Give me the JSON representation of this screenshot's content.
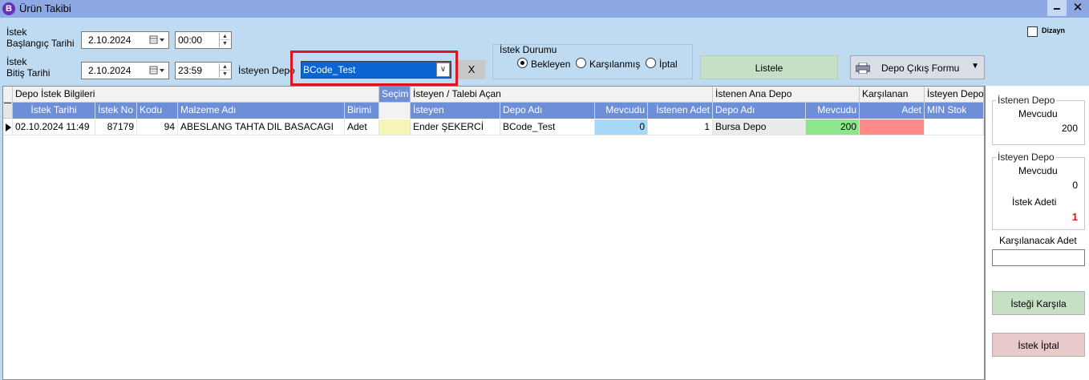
{
  "window": {
    "icon_letter": "B",
    "title": "Ürün Takibi",
    "minimize": "🗕",
    "close": "✕"
  },
  "filters": {
    "start_label_1": "İstek",
    "start_label_2": "Başlangıç Tarihi",
    "start_date": "2.10.2024",
    "start_time": "00:00",
    "end_label_1": "İstek",
    "end_label_2": "Bitiş Tarihi",
    "end_date": "2.10.2024",
    "end_time": "23:59",
    "depo_label": "İsteyen Depo",
    "depo_value": "BCode_Test",
    "clear_button": "X"
  },
  "status": {
    "title": "İstek Durumu",
    "options": [
      {
        "label": "Bekleyen",
        "selected": true
      },
      {
        "label": "Karşılanmış",
        "selected": false
      },
      {
        "label": "İptal",
        "selected": false
      }
    ]
  },
  "buttons": {
    "listele": "Listele",
    "cikis_formu": "Depo Çıkış Formu"
  },
  "dizayn": {
    "label": "Dizayn",
    "checked": false
  },
  "grid": {
    "bands": {
      "depo_istek": "Depo İstek Bilgileri",
      "secim": "Seçim",
      "isteyen": "İsteyen / Talebi Açan",
      "istenen_ana": "İstenen Ana Depo",
      "karsilanan": "Karşılanan",
      "isteyen_depo": "İsteyen Depo"
    },
    "columns": {
      "istek_tarihi": "İstek Tarihi",
      "istek_no": "İstek No",
      "kodu": "Kodu",
      "malzeme_adi": "Malzeme Adı",
      "birimi": "Birimi",
      "isteyen": "İsteyen",
      "depo_adi": "Depo Adı",
      "mevcudu": "Mevcudu",
      "istenen_adet": "İstenen Adet",
      "ana_depo_adi": "Depo Adı",
      "ana_mevcudu": "Mevcudu",
      "adet": "Adet",
      "min_stok": "MIN Stok"
    },
    "rows": [
      {
        "istek_tarihi": "02.10.2024 11:49",
        "istek_no": "87179",
        "kodu": "94",
        "malzeme_adi": "ABESLANG TAHTA DIL BASACAGI",
        "birimi": "Adet",
        "isteyen": "Ender ŞEKERCİ",
        "depo_adi": "BCode_Test",
        "mevcudu": "0",
        "istenen_adet": "1",
        "ana_depo_adi": "Bursa Depo",
        "ana_mevcudu": "200",
        "adet": "",
        "min_stok": ""
      }
    ]
  },
  "side": {
    "istenen_depo_title": "İstenen Depo",
    "istenen_mevcudu_label": "Mevcudu",
    "istenen_mevcudu_value": "200",
    "isteyen_depo_title": "İsteyen Depo",
    "isteyen_mevcudu_label": "Mevcudu",
    "isteyen_mevcudu_value": "0",
    "istek_adeti_label": "İstek Adeti",
    "istek_adeti_value": "1",
    "karsilanacak_label": "Karşılanacak Adet",
    "karsilanacak_value": "",
    "karsila_button": "İsteği Karşıla",
    "iptal_button": "İstek İptal"
  },
  "colors": {
    "header_blue": "#6d8fd8",
    "mevcudu_cell": "#a7d8f8",
    "ana_mevcudu_cell": "#8de68c",
    "adet_cell": "#ff8a8a",
    "secim_cell": "#f6f6b8",
    "istek_adeti_red": "#e0141e"
  }
}
